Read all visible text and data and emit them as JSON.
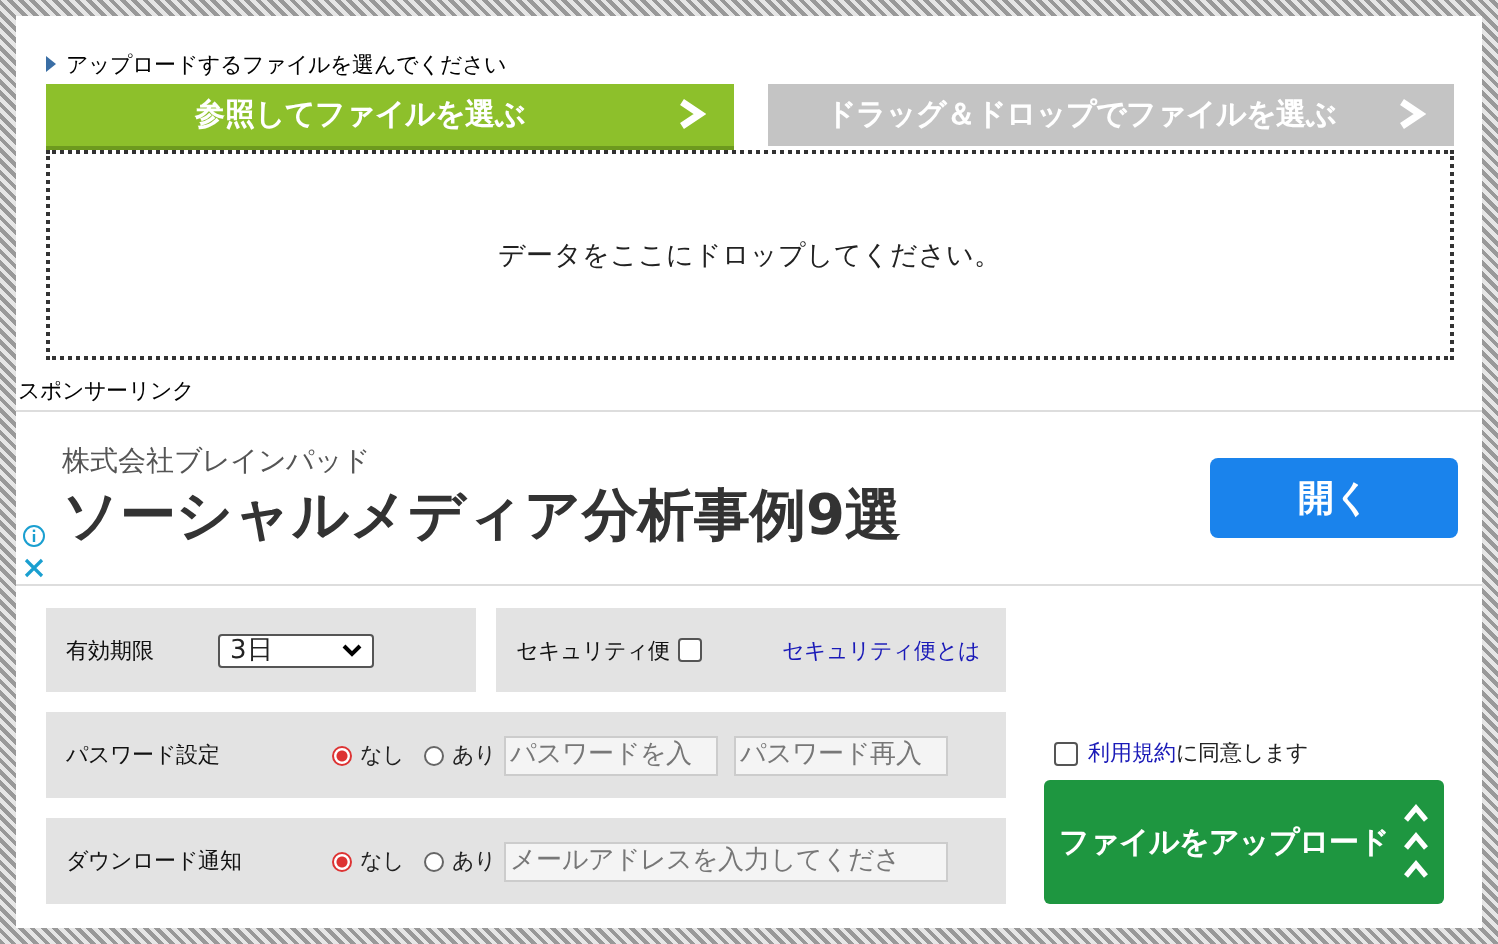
{
  "instruction": "アップロードするファイルを選んでください",
  "tabs": [
    {
      "label": "参照してファイルを選ぶ",
      "selected": true
    },
    {
      "label": "ドラッグ＆ドロップでファイルを選ぶ",
      "selected": false
    }
  ],
  "drop_zone": {
    "text": "データをここにドロップしてください。"
  },
  "sponsor_label": "スポンサーリンク",
  "ad": {
    "advertiser": "株式会社ブレインパッド",
    "headline": "ソーシャルメディア分析事例9選",
    "button": "開く"
  },
  "expiry": {
    "label": "有効期限",
    "value": "3日"
  },
  "security": {
    "label": "セキュリティ便",
    "checked": false,
    "link": "セキュリティ便とは"
  },
  "password": {
    "label": "パスワード設定",
    "options": [
      {
        "label": "なし",
        "selected": true
      },
      {
        "label": "あり",
        "selected": false
      }
    ],
    "fields": [
      {
        "placeholder": "パスワードを入"
      },
      {
        "placeholder": "パスワード再入"
      }
    ]
  },
  "notification": {
    "label": "ダウンロード通知",
    "options": [
      {
        "label": "なし",
        "selected": true
      },
      {
        "label": "あり",
        "selected": false
      }
    ],
    "fields": [
      {
        "placeholder": "メールアドレスを入力してくださ"
      }
    ]
  },
  "terms": {
    "checked": false,
    "link": "利用規約",
    "text": "に同意します"
  },
  "upload_button": "ファイルをアップロード"
}
